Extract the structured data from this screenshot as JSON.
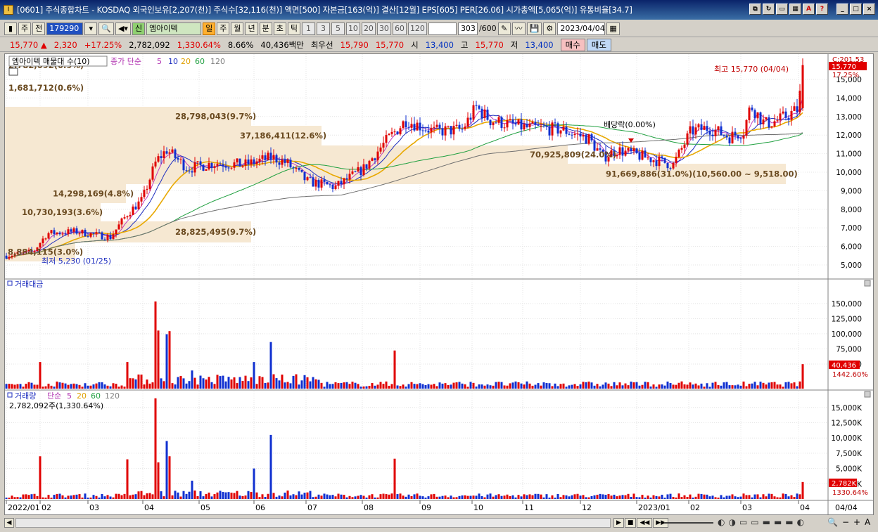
{
  "window": {
    "title": "[0601] 주식종합차트 - KOSDAQ 외국인보유[2,207(천)] 주식수[32,116(천)] 액면[500] 자본금[163(억)] 결산[12월] EPS[605] PER[26.06] 시가총액[5,065(억)] 유통비율[34.7]"
  },
  "toolbar": {
    "period_sel": "주",
    "prev": "전",
    "code": "179290",
    "name_badge": "신",
    "name": "엠아이텍",
    "periods": [
      "일",
      "주",
      "월",
      "년",
      "분",
      "초",
      "틱"
    ],
    "minutes": [
      "1",
      "3",
      "5",
      "10",
      "20",
      "30",
      "60",
      "120"
    ],
    "count": "303",
    "count_total": "/600",
    "date": "2023/04/04"
  },
  "quote": {
    "price": "15,770",
    "arrow": "▲",
    "change": "2,320",
    "change_pct": "+17.25%",
    "volume": "2,782,092",
    "vol_ratio": "1,330.64%",
    "turnover": "8.66%",
    "amount": "40,436백만",
    "pref_label": "최우선",
    "ask": "15,790",
    "bid": "15,770",
    "open_label": "시",
    "open": "13,400",
    "high_label": "고",
    "high": "15,770",
    "low_label": "저",
    "low": "13,400",
    "buy": "매수",
    "sell": "매도"
  },
  "price_panel": {
    "legend_name": "엠아이텍 매물대 수(10)",
    "ma_label": "종가 단순",
    "ma": [
      "5",
      "10",
      "20",
      "60",
      "120"
    ],
    "y_ticks": [
      "15,000",
      "14,000",
      "13,000",
      "12,000",
      "11,000",
      "10,000",
      "9,000",
      "8,000",
      "7,000",
      "6,000",
      "5,000"
    ],
    "current_label": "15,770",
    "current_pct": "17.25%",
    "c_label": "C:201.53",
    "high_note": "최고 15,770 (04/04)",
    "low_note": "최저 5,230 (01/25)",
    "div_note": "배당락(0.00%)",
    "vp_labels": [
      "2,782,092(0.9%)",
      "1,681,712(0.6%)",
      "28,798,043(9.7%)",
      "37,186,411(12.6%)",
      "70,925,809(24.0%)",
      "91,669,886(31.0%)(10,560.00 ~ 9,518.00)",
      "14,298,169(4.8%)",
      "10,730,193(3.6%)",
      "28,825,495(9.7%)",
      "8,884,115(3.0%)"
    ]
  },
  "amount_panel": {
    "label": "거래대금",
    "y_ticks": [
      "150,000",
      "125,000",
      "100,000",
      "75,000",
      "50,000"
    ],
    "current": "40,436",
    "pct": "1442.60%"
  },
  "volume_panel": {
    "label": "거래량",
    "ma_label": "단순",
    "ma": [
      "5",
      "20",
      "60",
      "120"
    ],
    "value_line": "2,782,092주(1,330.64%)",
    "y_ticks": [
      "15,000K",
      "12,500K",
      "10,000K",
      "7,500K",
      "5,000K",
      "2,500K"
    ],
    "current": "2,782K",
    "pct": "1330.64%"
  },
  "x_labels": [
    "2022/01",
    "02",
    "03",
    "04",
    "05",
    "06",
    "07",
    "08",
    "09",
    "10",
    "11",
    "12",
    "2023/01",
    "02",
    "03",
    "04"
  ],
  "x_right": "04/04",
  "chart_data": {
    "type": "candlestick",
    "x_labels": [
      "2022/01",
      "02",
      "03",
      "04",
      "05",
      "06",
      "07",
      "08",
      "09",
      "10",
      "11",
      "12",
      "2023/01",
      "02",
      "03",
      "04"
    ],
    "ylim": [
      4500,
      16000
    ],
    "high": 15770,
    "low": 5230,
    "last": 15770
  }
}
